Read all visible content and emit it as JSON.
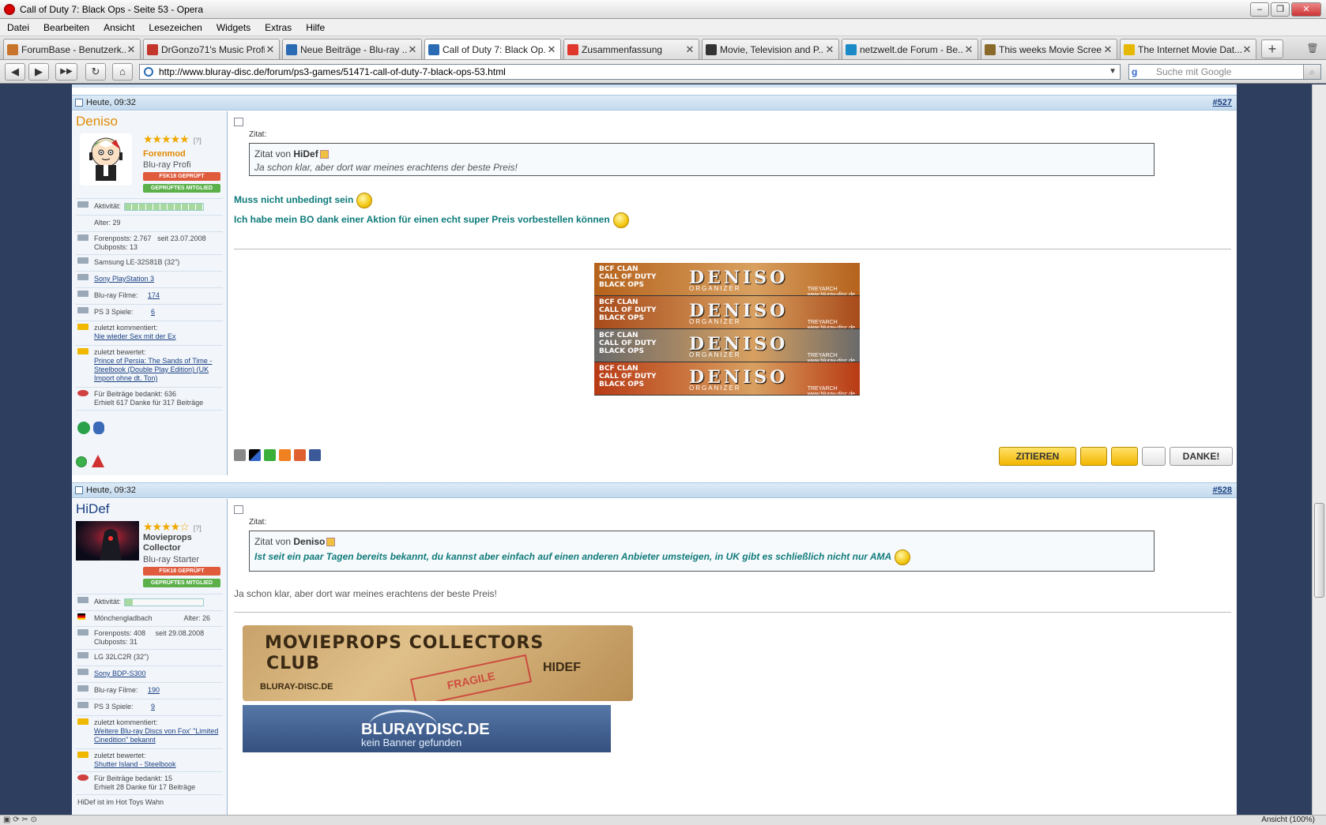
{
  "window": {
    "title": "Call of Duty 7: Black Ops - Seite 53 - Opera",
    "min": "–",
    "max": "❐",
    "close": "✕"
  },
  "menu": [
    "Datei",
    "Bearbeiten",
    "Ansicht",
    "Lesezeichen",
    "Widgets",
    "Extras",
    "Hilfe"
  ],
  "tabs": [
    {
      "label": "ForumBase - Benutzerk...",
      "color": "#c8742a"
    },
    {
      "label": "DrGonzo71's Music Profil...",
      "color": "#c3362b"
    },
    {
      "label": "Neue Beiträge - Blu-ray ...",
      "color": "#2a6bb3"
    },
    {
      "label": "Call of Duty 7: Black Op...",
      "color": "#2a6bb3"
    },
    {
      "label": "Zusammenfassung",
      "color": "#e0362b"
    },
    {
      "label": "Movie, Television and P...",
      "color": "#333333"
    },
    {
      "label": "netzwelt.de Forum - Be...",
      "color": "#1a8ac8"
    },
    {
      "label": "This weeks Movie Scree...",
      "color": "#8a6a2a"
    },
    {
      "label": "The Internet Movie Dat...",
      "color": "#e6b800"
    }
  ],
  "tab_close": "✕",
  "newtab": "+",
  "nav": {
    "back": "◀",
    "forward": "▶",
    "fastforward": "▶▶",
    "reload": "↻",
    "home": "⌂"
  },
  "address": {
    "url": "http://www.bluray-disc.de/forum/ps3-games/51471-call-of-duty-7-black-ops-53.html",
    "dropdown": "▼"
  },
  "search": {
    "placeholder": "Suche mit Google",
    "engine": "g",
    "go": "⌕"
  },
  "posts": [
    {
      "date": "Heute, 09:32",
      "number": "#527",
      "user": {
        "name": "Deniso",
        "name_color": "#e08a00",
        "stars": "★★★★★",
        "help": "[?]",
        "rank": "Forenmod",
        "rank_color": "#e08a00",
        "title": "Blu-ray Profi",
        "badge1": "FSK18 GEPRÜFT",
        "badge2": "GEPRÜFTES MITGLIED"
      },
      "stats": {
        "activity_label": "Aktivität:",
        "age": "Alter: 29",
        "posts": "Forenposts: 2.767",
        "since": "seit 23.07.2008",
        "clubposts": "Clubposts: 13",
        "tv": "Samsung LE-32S81B (32\")",
        "player": "Sony PlayStation 3",
        "bluray_label": "Blu-ray Filme:",
        "bluray_count": "174",
        "ps3_label": "PS 3 Spiele:",
        "ps3_count": "6",
        "commented_label": "zuletzt kommentiert:",
        "commented": "Nie wieder Sex mit der Ex",
        "rated_label": "zuletzt bewertet:",
        "rated": "Prince of Persia: The Sands of Time - Steelbook (Double Play Edition) (UK Import ohne dt. Ton)",
        "thanked": "Für Beiträge bedankt: 636",
        "received": "Erhielt 617 Danke für 317 Beiträge"
      },
      "quote": {
        "label": "Zitat:",
        "by_prefix": "Zitat von",
        "by": "HiDef",
        "text": "Ja schon klar, aber dort war meines erachtens der beste Preis!"
      },
      "lines": [
        "Muss nicht unbedingt sein",
        "Ich habe mein BO dank einer Aktion für einen echt super Preis vorbestellen können"
      ],
      "sig": {
        "clan": "BCF CLAN",
        "game": "CALL OF DUTY",
        "sub": "BLACK OPS",
        "name": "DENISO",
        "role": "ORGANIZER",
        "studio": "TREYARCH",
        "site": "www.bluray-disc.de",
        "colors": [
          "#b5621c",
          "#a84a1a",
          "#6a6a6a",
          "#b83a14"
        ]
      },
      "buttons": {
        "quote": "ZITIEREN",
        "thanks": "DANKE!"
      }
    },
    {
      "date": "Heute, 09:32",
      "number": "#528",
      "user": {
        "name": "HiDef",
        "name_color": "#1a3f80",
        "stars": "★★★★☆",
        "help": "[?]",
        "rank": "Movieprops Collector",
        "rank_color": "#444444",
        "title": "Blu-ray Starter",
        "badge1": "FSK18 GEPRÜFT",
        "badge2": "GEPRÜFTES MITGLIED"
      },
      "stats": {
        "activity_label": "Aktivität:",
        "city": "Mönchengladbach",
        "age": "Alter: 26",
        "posts": "Forenposts: 408",
        "since": "seit 29.08.2008",
        "clubposts": "Clubposts: 31",
        "tv": "LG 32LC2R (32\")",
        "player": "Sony BDP-S300",
        "bluray_label": "Blu-ray Filme:",
        "bluray_count": "190",
        "ps3_label": "PS 3 Spiele:",
        "ps3_count": "9",
        "commented_label": "zuletzt kommentiert:",
        "commented": "Weitere Blu-ray Discs von Fox' \"Limited Cinedition\" bekannt",
        "rated_label": "zuletzt bewertet:",
        "rated": "Shutter Island - Steelbook",
        "thanked": "Für Beiträge bedankt: 15",
        "received": "Erhielt 28 Danke für 17 Beiträge",
        "more": "HiDef ist im Hot Toys Wahn"
      },
      "quote": {
        "label": "Zitat:",
        "by_prefix": "Zitat von",
        "by": "Deniso",
        "text": "Ist seit ein paar Tagen bereits bekannt, du kannst aber einfach auf einen anderen Anbieter umsteigen, in UK gibt es schließlich nicht nur AMA"
      },
      "reply": "Ja schon klar, aber dort war meines erachtens der beste Preis!",
      "banner1": {
        "title": "MOVIEPROPS COLLECTORS",
        "club": "CLUB",
        "user": "HIDEF",
        "fragile": "FRAGILE",
        "brand": "BLURAY-DISC.DE"
      },
      "banner2": {
        "title": "BLURAYDISC.DE",
        "sub": "kein Banner gefunden"
      }
    }
  ],
  "status": {
    "zoom": "Ansicht (100%)"
  }
}
